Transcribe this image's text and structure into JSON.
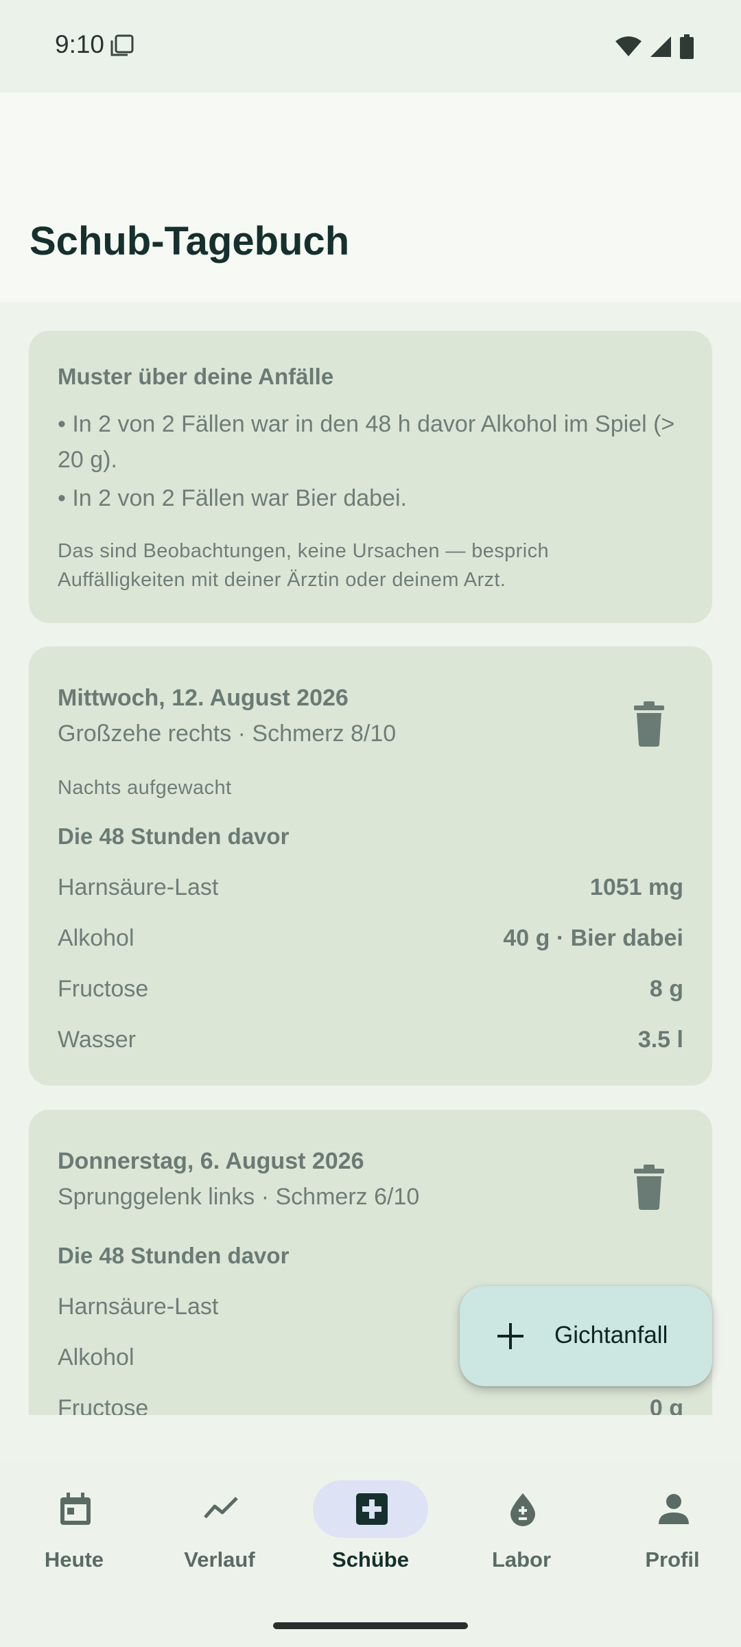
{
  "status_bar": {
    "time": "9:10"
  },
  "app_bar": {
    "title": "Schub-Tagebuch"
  },
  "muster_card": {
    "title": "Muster über deine Anfälle",
    "bullets": [
      "• In 2 von 2 Fällen war in den 48 h davor Alkohol im Spiel (> 20 g).",
      "• In 2 von 2 Fällen war Bier dabei."
    ],
    "disclaimer": "Das sind Beobachtungen, keine Ursachen — besprich Auffälligkeiten mit deiner Ärztin oder deinem Arzt."
  },
  "flares": [
    {
      "date": "Mittwoch, 12. August 2026",
      "subtitle": "Großzehe rechts · Schmerz 8/10",
      "note": "Nachts aufgewacht",
      "section_title": "Die 48 Stunden davor",
      "rows": [
        {
          "label": "Harnsäure-Last",
          "value": "1051 mg"
        },
        {
          "label": "Alkohol",
          "value": "40 g · Bier dabei"
        },
        {
          "label": "Fructose",
          "value": "8 g"
        },
        {
          "label": "Wasser",
          "value": "3.5 l"
        }
      ]
    },
    {
      "date": "Donnerstag, 6. August 2026",
      "subtitle": "Sprunggelenk links · Schmerz 6/10",
      "section_title": "Die 48 Stunden davor",
      "rows": [
        {
          "label": "Harnsäure-Last",
          "value": ""
        },
        {
          "label": "Alkohol",
          "value": ""
        },
        {
          "label": "Fructose",
          "value": "0 g"
        }
      ]
    }
  ],
  "fab": {
    "label": "Gichtanfall",
    "icon": "plus-icon"
  },
  "bottom_nav": {
    "items": [
      {
        "label": "Heute",
        "icon": "calendar-icon",
        "active": false
      },
      {
        "label": "Verlauf",
        "icon": "trend-line-icon",
        "active": false
      },
      {
        "label": "Schübe",
        "icon": "medical-cross-icon",
        "active": true
      },
      {
        "label": "Labor",
        "icon": "blood-drop-icon",
        "active": false
      },
      {
        "label": "Profil",
        "icon": "person-icon",
        "active": false
      }
    ]
  },
  "colors": {
    "card_bg": "#DCE6D6",
    "fab_bg": "#CCE6E2",
    "nav_active_pill": "#DDE3F5",
    "app_bar_bg": "#F7FAF4"
  }
}
